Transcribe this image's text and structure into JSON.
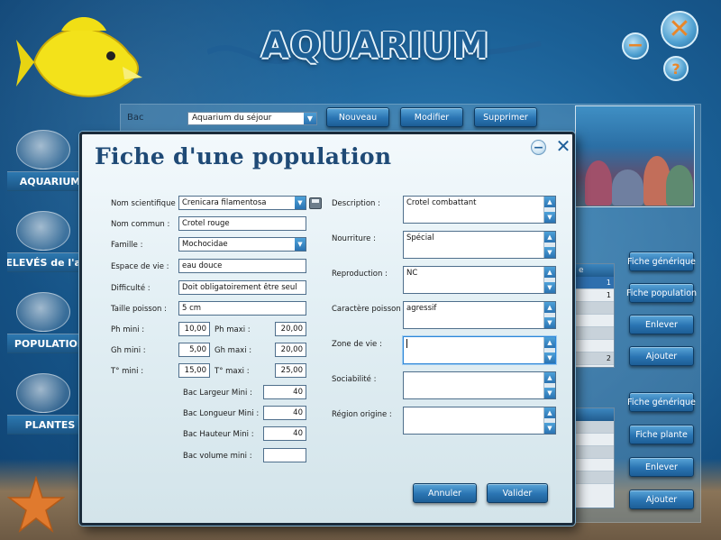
{
  "app": {
    "logo_text": "AQUARIUM",
    "window_controls": {
      "close_glyph": "✕",
      "minimize_glyph": "−",
      "help_glyph": "?"
    }
  },
  "nav": {
    "items": [
      {
        "label": "AQUARIUM",
        "icon": "fishbowl-icon"
      },
      {
        "label": "RELEVÉS de l'aqua",
        "icon": "notebook-icon"
      },
      {
        "label": "POPULATION",
        "icon": "fish-group-icon"
      },
      {
        "label": "PLANTES",
        "icon": "plant-icon"
      }
    ]
  },
  "topbar": {
    "bac_label": "Bac",
    "bac_value": "Aquarium du séjour",
    "buttons": {
      "new": "Nouveau",
      "edit": "Modifier",
      "delete": "Supprimer"
    }
  },
  "side_panel": {
    "population_buttons": {
      "generic": "Fiche générique",
      "sheet": "Fiche population",
      "remove": "Enlever",
      "add": "Ajouter"
    },
    "plant_buttons": {
      "generic": "Fiche générique",
      "sheet": "Fiche plante",
      "remove": "Enlever",
      "add": "Ajouter"
    },
    "grid_top_values": [
      "1",
      "1",
      "",
      "",
      "",
      "",
      "2"
    ],
    "grid_top_header": "e"
  },
  "modal": {
    "title": "Fiche d'une population",
    "minimize_glyph": "−",
    "close_glyph": "✕",
    "left": {
      "scientific_name": {
        "label": "Nom scientifique :",
        "value": "Crenicara filamentosa"
      },
      "common_name": {
        "label": "Nom commun :",
        "value": "Crotel rouge"
      },
      "family": {
        "label": "Famille :",
        "value": "Mochocidae"
      },
      "living_space": {
        "label": "Espace de vie :",
        "value": "eau douce"
      },
      "difficulty": {
        "label": "Difficulté :",
        "value": "Doit obligatoirement être seul"
      },
      "fish_size": {
        "label": "Taille poisson :",
        "value": "5 cm"
      },
      "ph_min": {
        "label": "Ph mini :",
        "value": "10,00"
      },
      "ph_max": {
        "label": "Ph maxi :",
        "value": "20,00"
      },
      "gh_min": {
        "label": "Gh mini :",
        "value": "5,00"
      },
      "gh_max": {
        "label": "Gh maxi :",
        "value": "20,00"
      },
      "t_min": {
        "label": "T° mini :",
        "value": "15,00"
      },
      "t_max": {
        "label": "T° maxi :",
        "value": "25,00"
      },
      "tank_width": {
        "label": "Bac Largeur Mini :",
        "value": "40"
      },
      "tank_length": {
        "label": "Bac Longueur Mini :",
        "value": "40"
      },
      "tank_height": {
        "label": "Bac Hauteur Mini :",
        "value": "40"
      },
      "tank_volume": {
        "label": "Bac volume mini :",
        "value": ""
      }
    },
    "right": {
      "description": {
        "label": "Description :",
        "value": "Crotel combattant"
      },
      "food": {
        "label": "Nourriture :",
        "value": "Spécial"
      },
      "reproduction": {
        "label": "Reproduction :",
        "value": "NC"
      },
      "character": {
        "label": "Caractère poisson :",
        "value": "agressif"
      },
      "life_zone": {
        "label": "Zone de vie :",
        "value": ""
      },
      "sociability": {
        "label": "Sociabilité :",
        "value": ""
      },
      "origin_region": {
        "label": "Région origine :",
        "value": ""
      }
    },
    "buttons": {
      "cancel": "Annuler",
      "validate": "Valider"
    }
  }
}
